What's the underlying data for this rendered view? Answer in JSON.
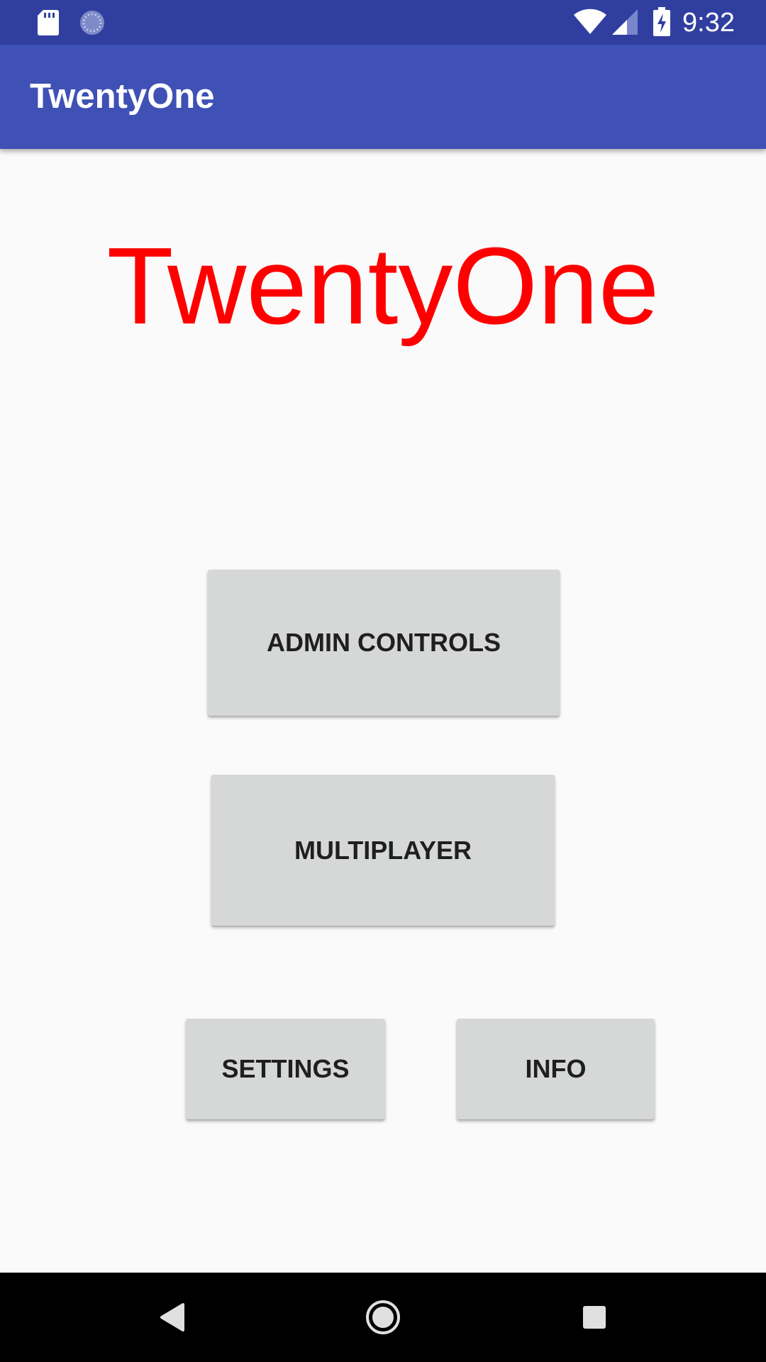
{
  "status_bar": {
    "time": "9:32",
    "icons": [
      "sd-card-icon",
      "sync-icon",
      "wifi-icon",
      "cell-signal-icon",
      "battery-charging-icon"
    ]
  },
  "app_bar": {
    "title": "TwentyOne"
  },
  "main": {
    "heading": "TwentyOne",
    "buttons": {
      "admin": "ADMIN CONTROLS",
      "multiplayer": "MULTIPLAYER",
      "settings": "SETTINGS",
      "info": "INFO"
    }
  },
  "nav_bar": {
    "icons": [
      "back-icon",
      "home-icon",
      "recents-icon"
    ]
  },
  "colors": {
    "status_bar": "#303f9f",
    "app_bar": "#3f51b5",
    "heading": "#ff0000",
    "button_bg": "#d6d7d7",
    "background": "#fafafa",
    "nav_bar": "#000000"
  }
}
